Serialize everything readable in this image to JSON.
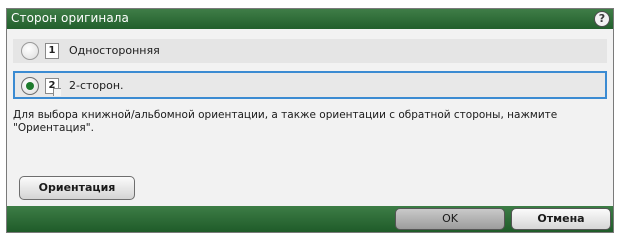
{
  "dialog": {
    "title": "Сторон оригинала",
    "help_glyph": "?",
    "help_icon": "help-icon"
  },
  "options": [
    {
      "number": "1",
      "label": "Односторонняя",
      "selected": false
    },
    {
      "number": "2",
      "label": "2-сторон.",
      "selected": true
    }
  ],
  "description": "Для выбора книжной/альбомной ориентации, а также ориентации с обратной стороны, нажмите \"Ориентация\".",
  "buttons": {
    "orientation": "Ориентация",
    "ok": "OK",
    "cancel": "Отмена"
  },
  "colors": {
    "title_bar": "#2f6f3a",
    "selection_border": "#3b8bd2",
    "radio_selected": "#1d7a2c"
  }
}
